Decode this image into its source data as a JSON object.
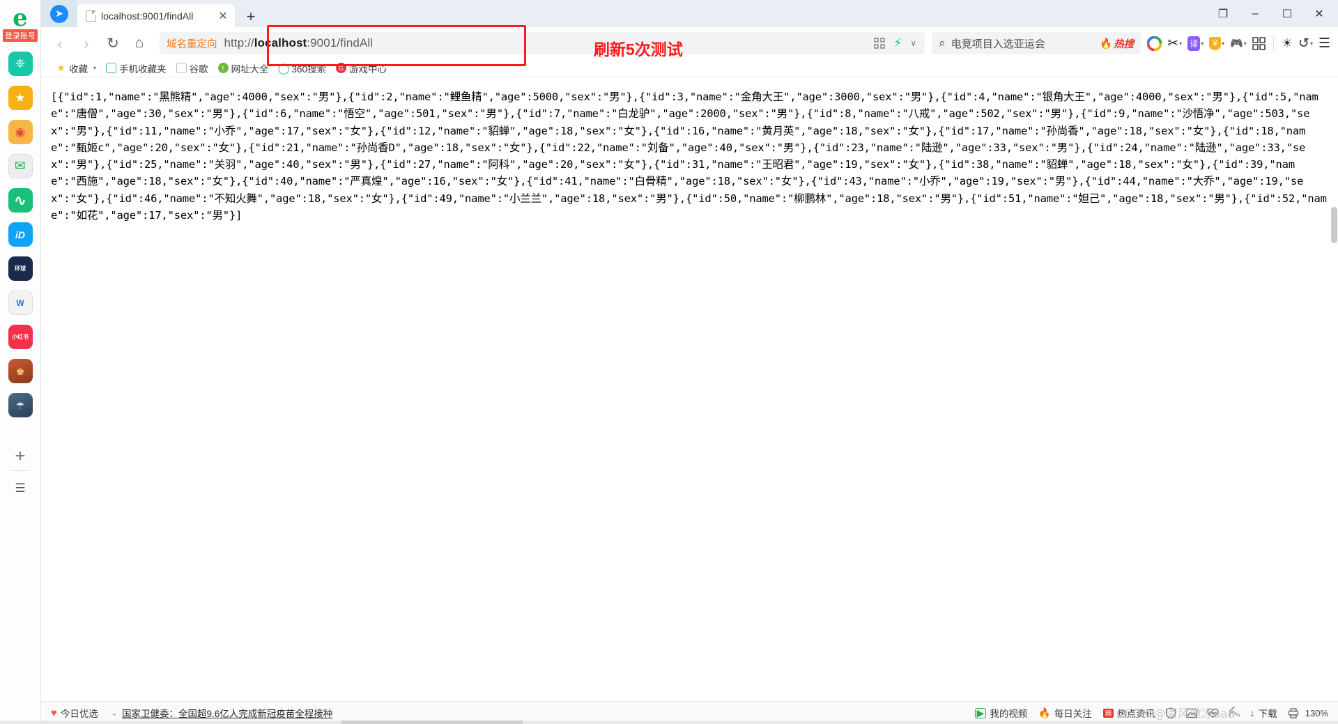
{
  "window": {
    "minimize_label": "–",
    "maximize_label": "☐",
    "close_label": "✕",
    "collections_label": "❐"
  },
  "sidebar": {
    "logo_glyph": "e",
    "login_label": "登录账号",
    "items": [
      {
        "name": "sidebar-app-qq",
        "glyph": "❈",
        "color": "#16c7a8"
      },
      {
        "name": "sidebar-app-favorites",
        "glyph": "★",
        "color": "#f7b015"
      },
      {
        "name": "sidebar-app-weibo",
        "glyph": "◉",
        "color": "#f6b545"
      },
      {
        "name": "sidebar-app-mail",
        "glyph": "✉",
        "color": "#e8e8e8"
      },
      {
        "name": "sidebar-app-cloud",
        "glyph": "∿",
        "color": "#18c07a"
      },
      {
        "name": "sidebar-app-iqiyi",
        "glyph": "iD",
        "color": "#11a3f5"
      },
      {
        "name": "sidebar-app-huanqiu",
        "glyph": "环球",
        "color": "#1b2a4a"
      },
      {
        "name": "sidebar-app-wps",
        "glyph": "W",
        "color": "#eeeeee"
      },
      {
        "name": "sidebar-app-xiaohongshu",
        "glyph": "小红书",
        "color": "#f5304a"
      },
      {
        "name": "sidebar-app-game1",
        "glyph": "♚",
        "color": "#b8492c"
      },
      {
        "name": "sidebar-app-game2",
        "glyph": "☂",
        "color": "#3d5a7a"
      }
    ],
    "add_label": "+",
    "list_label": "☰"
  },
  "tabs": {
    "items": [
      {
        "title": "localhost:9001/findAll",
        "close_label": "✕"
      }
    ],
    "new_tab_label": "+"
  },
  "nav": {
    "back_label": "‹",
    "forward_label": "›",
    "reload_label": "↻",
    "home_label": "⌂",
    "url_badge": "域名重定向",
    "url_prefix": "http://",
    "url_host": "localhost",
    "url_suffix": ":9001/findAll",
    "url_full": "http://localhost:9001/findAll",
    "qrcode_icon": "░",
    "lightning_icon": "⚡",
    "chevron_icon": "∨"
  },
  "search": {
    "icon": "⌕",
    "query": "电竞项目入选亚运会",
    "hot_badge": "热搜",
    "hot_flame": "🔥"
  },
  "toolbar": {
    "items": [
      {
        "name": "color-circle-icon",
        "glyph": "◉",
        "caret": false
      },
      {
        "name": "scissors-screenshot-icon",
        "glyph": "✂",
        "caret": true
      },
      {
        "name": "translate-icon",
        "glyph": "译",
        "caret": true
      },
      {
        "name": "shopping-shield-icon",
        "glyph": "¥",
        "caret": true
      },
      {
        "name": "game-controller-icon",
        "glyph": "🎮",
        "caret": true
      },
      {
        "name": "apps-grid-icon",
        "glyph": "▒",
        "caret": false
      },
      {
        "name": "brightness-icon",
        "glyph": "☀",
        "caret": false
      },
      {
        "name": "undo-icon",
        "glyph": "↶",
        "caret": true
      },
      {
        "name": "menu-hamburger-icon",
        "glyph": "☰",
        "caret": false
      }
    ]
  },
  "bookmarks": {
    "items": [
      {
        "label": "收藏",
        "icon": "★",
        "color": "#f7c11c",
        "caret": true
      },
      {
        "label": "手机收藏夹",
        "icon": "▯",
        "color": "#3fbf6a",
        "caret": false
      },
      {
        "label": "谷歌",
        "icon": "□",
        "color": "#cccccc",
        "caret": false
      },
      {
        "label": "网址大全",
        "icon": "↑",
        "color": "#6db93b",
        "caret": false
      },
      {
        "label": "360搜索",
        "icon": "◯",
        "color": "#13b573",
        "caret": false
      },
      {
        "label": "游戏中心",
        "icon": "G",
        "color": "#e0344a",
        "caret": false
      }
    ]
  },
  "annotations": {
    "callout_text": "刷新5次测试",
    "accent_color": "#ff1a1a"
  },
  "page": {
    "body_text": "[{\"id\":1,\"name\":\"黑熊精\",\"age\":4000,\"sex\":\"男\"},{\"id\":2,\"name\":\"鲤鱼精\",\"age\":5000,\"sex\":\"男\"},{\"id\":3,\"name\":\"金角大王\",\"age\":3000,\"sex\":\"男\"},{\"id\":4,\"name\":\"银角大王\",\"age\":4000,\"sex\":\"男\"},{\"id\":5,\"name\":\"唐僧\",\"age\":30,\"sex\":\"男\"},{\"id\":6,\"name\":\"悟空\",\"age\":501,\"sex\":\"男\"},{\"id\":7,\"name\":\"白龙驴\",\"age\":2000,\"sex\":\"男\"},{\"id\":8,\"name\":\"八戒\",\"age\":502,\"sex\":\"男\"},{\"id\":9,\"name\":\"沙悟净\",\"age\":503,\"sex\":\"男\"},{\"id\":11,\"name\":\"小乔\",\"age\":17,\"sex\":\"女\"},{\"id\":12,\"name\":\"貂蝉\",\"age\":18,\"sex\":\"女\"},{\"id\":16,\"name\":\"黄月英\",\"age\":18,\"sex\":\"女\"},{\"id\":17,\"name\":\"孙尚香\",\"age\":18,\"sex\":\"女\"},{\"id\":18,\"name\":\"甄姬c\",\"age\":20,\"sex\":\"女\"},{\"id\":21,\"name\":\"孙尚香D\",\"age\":18,\"sex\":\"女\"},{\"id\":22,\"name\":\"刘备\",\"age\":40,\"sex\":\"男\"},{\"id\":23,\"name\":\"陆逊\",\"age\":33,\"sex\":\"男\"},{\"id\":24,\"name\":\"陆逊\",\"age\":33,\"sex\":\"男\"},{\"id\":25,\"name\":\"关羽\",\"age\":40,\"sex\":\"男\"},{\"id\":27,\"name\":\"阿科\",\"age\":20,\"sex\":\"女\"},{\"id\":31,\"name\":\"王昭君\",\"age\":19,\"sex\":\"女\"},{\"id\":38,\"name\":\"貂蝉\",\"age\":18,\"sex\":\"女\"},{\"id\":39,\"name\":\"西施\",\"age\":18,\"sex\":\"女\"},{\"id\":40,\"name\":\"严真煌\",\"age\":16,\"sex\":\"女\"},{\"id\":41,\"name\":\"白骨精\",\"age\":18,\"sex\":\"女\"},{\"id\":43,\"name\":\"小乔\",\"age\":19,\"sex\":\"男\"},{\"id\":44,\"name\":\"大乔\",\"age\":19,\"sex\":\"女\"},{\"id\":46,\"name\":\"不知火舞\",\"age\":18,\"sex\":\"女\"},{\"id\":49,\"name\":\"小兰兰\",\"age\":18,\"sex\":\"男\"},{\"id\":50,\"name\":\"柳鹏林\",\"age\":18,\"sex\":\"男\"},{\"id\":51,\"name\":\"妲己\",\"age\":18,\"sex\":\"男\"},{\"id\":52,\"name\":\"如花\",\"age\":17,\"sex\":\"男\"}]",
    "records": [
      {
        "id": 1,
        "name": "黑熊精",
        "age": 4000,
        "sex": "男"
      },
      {
        "id": 2,
        "name": "鲤鱼精",
        "age": 5000,
        "sex": "男"
      },
      {
        "id": 3,
        "name": "金角大王",
        "age": 3000,
        "sex": "男"
      },
      {
        "id": 4,
        "name": "银角大王",
        "age": 4000,
        "sex": "男"
      },
      {
        "id": 5,
        "name": "唐僧",
        "age": 30,
        "sex": "男"
      },
      {
        "id": 6,
        "name": "悟空",
        "age": 501,
        "sex": "男"
      },
      {
        "id": 7,
        "name": "白龙驴",
        "age": 2000,
        "sex": "男"
      },
      {
        "id": 8,
        "name": "八戒",
        "age": 502,
        "sex": "男"
      },
      {
        "id": 9,
        "name": "沙悟净",
        "age": 503,
        "sex": "男"
      },
      {
        "id": 11,
        "name": "小乔",
        "age": 17,
        "sex": "女"
      },
      {
        "id": 12,
        "name": "貂蝉",
        "age": 18,
        "sex": "女"
      },
      {
        "id": 16,
        "name": "黄月英",
        "age": 18,
        "sex": "女"
      },
      {
        "id": 17,
        "name": "孙尚香",
        "age": 18,
        "sex": "女"
      },
      {
        "id": 18,
        "name": "甄姬c",
        "age": 20,
        "sex": "女"
      },
      {
        "id": 21,
        "name": "孙尚香D",
        "age": 18,
        "sex": "女"
      },
      {
        "id": 22,
        "name": "刘备",
        "age": 40,
        "sex": "男"
      },
      {
        "id": 23,
        "name": "陆逊",
        "age": 33,
        "sex": "男"
      },
      {
        "id": 24,
        "name": "陆逊",
        "age": 33,
        "sex": "男"
      },
      {
        "id": 25,
        "name": "关羽",
        "age": 40,
        "sex": "男"
      },
      {
        "id": 27,
        "name": "阿科",
        "age": 20,
        "sex": "女"
      },
      {
        "id": 31,
        "name": "王昭君",
        "age": 19,
        "sex": "女"
      },
      {
        "id": 38,
        "name": "貂蝉",
        "age": 18,
        "sex": "女"
      },
      {
        "id": 39,
        "name": "西施",
        "age": 18,
        "sex": "女"
      },
      {
        "id": 40,
        "name": "严真煌",
        "age": 16,
        "sex": "女"
      },
      {
        "id": 41,
        "name": "白骨精",
        "age": 18,
        "sex": "女"
      },
      {
        "id": 43,
        "name": "小乔",
        "age": 19,
        "sex": "男"
      },
      {
        "id": 44,
        "name": "大乔",
        "age": 19,
        "sex": "女"
      },
      {
        "id": 46,
        "name": "不知火舞",
        "age": 18,
        "sex": "女"
      },
      {
        "id": 49,
        "name": "小兰兰",
        "age": 18,
        "sex": "男"
      },
      {
        "id": 50,
        "name": "柳鹏林",
        "age": 18,
        "sex": "男"
      },
      {
        "id": 51,
        "name": "妲己",
        "age": 18,
        "sex": "男"
      },
      {
        "id": 52,
        "name": "如花",
        "age": 17,
        "sex": "男"
      }
    ]
  },
  "status": {
    "today_label": "今日优选",
    "news_headline": "国家卫健委：全国超9.6亿人完成新冠疫苗全程接种",
    "my_video": "我的视频",
    "daily_follow": "每日关注",
    "hot_news": "热点资讯",
    "download": "下载",
    "zoom_level": "130%",
    "watermark": "CSDN @清风微凉aaa",
    "icons": [
      {
        "name": "shield-icon",
        "glyph": "⛨"
      },
      {
        "name": "image-icon",
        "glyph": "⛰"
      },
      {
        "name": "heart-monitor-icon",
        "glyph": "♡"
      },
      {
        "name": "magnet-icon",
        "glyph": "⚷"
      },
      {
        "name": "download-icon",
        "glyph": "↓"
      },
      {
        "name": "printer-icon",
        "glyph": "⎙"
      }
    ]
  }
}
